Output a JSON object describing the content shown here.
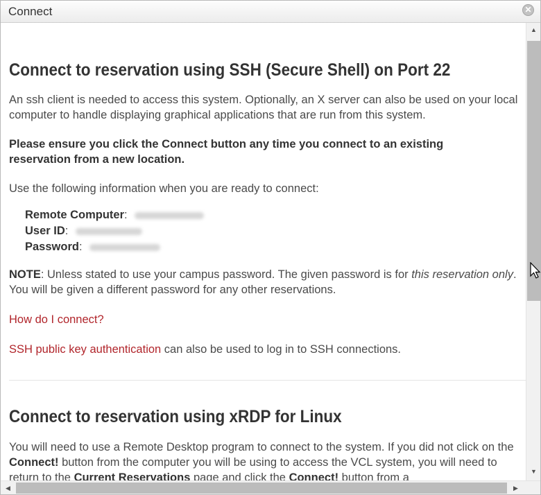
{
  "window": {
    "title": "Connect",
    "close_icon": "close-icon"
  },
  "ssh": {
    "heading": "Connect to reservation using SSH (Secure Shell) on Port 22",
    "intro": "An ssh client is needed to access this system. Optionally, an X server can also be used on your local computer to handle displaying graphical applications that are run from this system.",
    "warning": "Please ensure you click the Connect button any time you connect to an existing reservation from a new location.",
    "info_intro": "Use the following information when you are ready to connect:",
    "remote_computer_label": "Remote Computer",
    "user_id_label": "User ID",
    "password_label": "Password",
    "separator": ":",
    "note_label": "NOTE",
    "note_text_1": ": Unless stated to use your campus password. The given password is for ",
    "note_emphasis": "this reservation only",
    "note_text_2": ". You will be given a different password for any other reservations.",
    "how_link": "How do I connect?",
    "ssh_key_link": "SSH public key authentication",
    "ssh_key_text": " can also be used to log in to SSH connections."
  },
  "xrdp": {
    "heading": "Connect to reservation using xRDP for Linux",
    "text_1": "You will need to use a Remote Desktop program to connect to the system. If you did not click on the ",
    "connect_1": "Connect!",
    "text_2": " button from the computer you will be using to access the VCL system, you will need to return to the ",
    "current_reservations": "Current Reservations",
    "text_3": " page and click the ",
    "connect_2": "Connect!",
    "text_4": " button from a"
  },
  "scrollbars": {
    "up_arrow": "▲",
    "down_arrow": "▼",
    "left_arrow": "◀",
    "right_arrow": "▶",
    "vertical_position": 0.0
  },
  "colors": {
    "link": "#b1252b",
    "scroll_thumb": "#bcbcbc"
  }
}
